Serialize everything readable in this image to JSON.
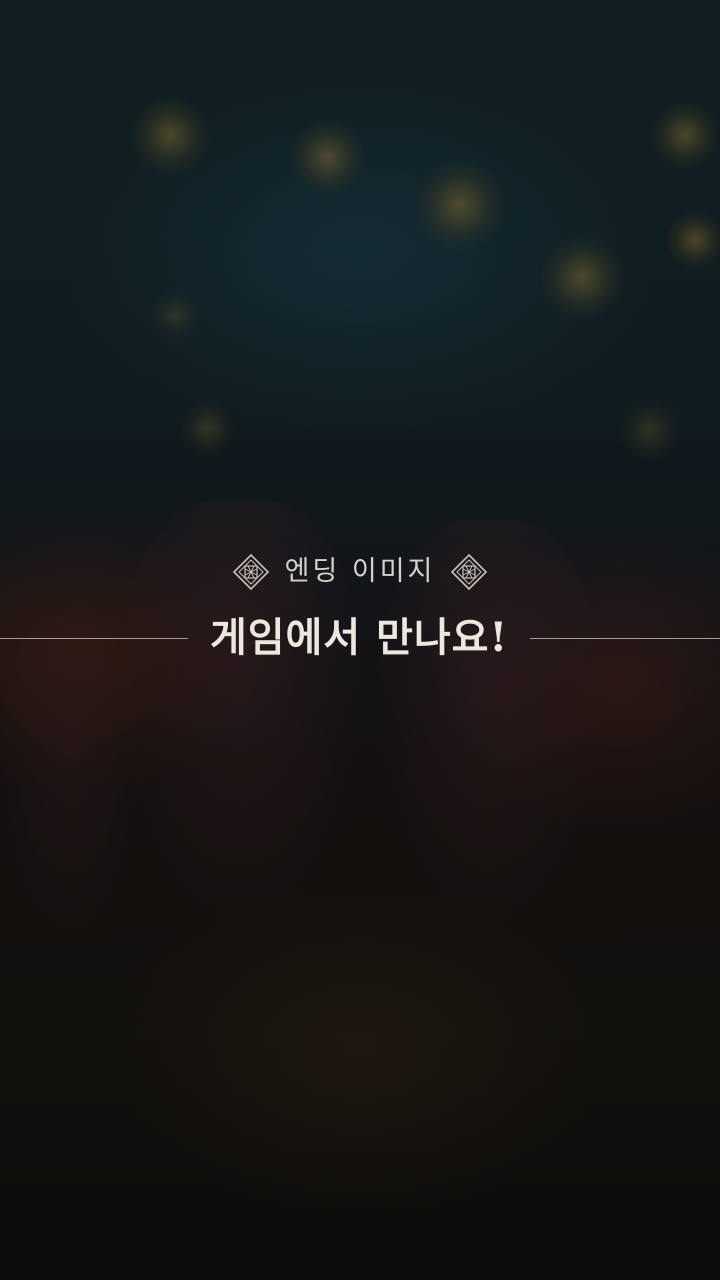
{
  "ending": {
    "subtitle": "엔딩 이미지",
    "title": "게임에서 만나요!"
  },
  "icons": {
    "left_emblem": "diamond-ornament-icon",
    "right_emblem": "diamond-ornament-icon"
  },
  "colors": {
    "text": "#ece8e0",
    "line": "#d2cdc3",
    "bokeh": "#96783a"
  }
}
